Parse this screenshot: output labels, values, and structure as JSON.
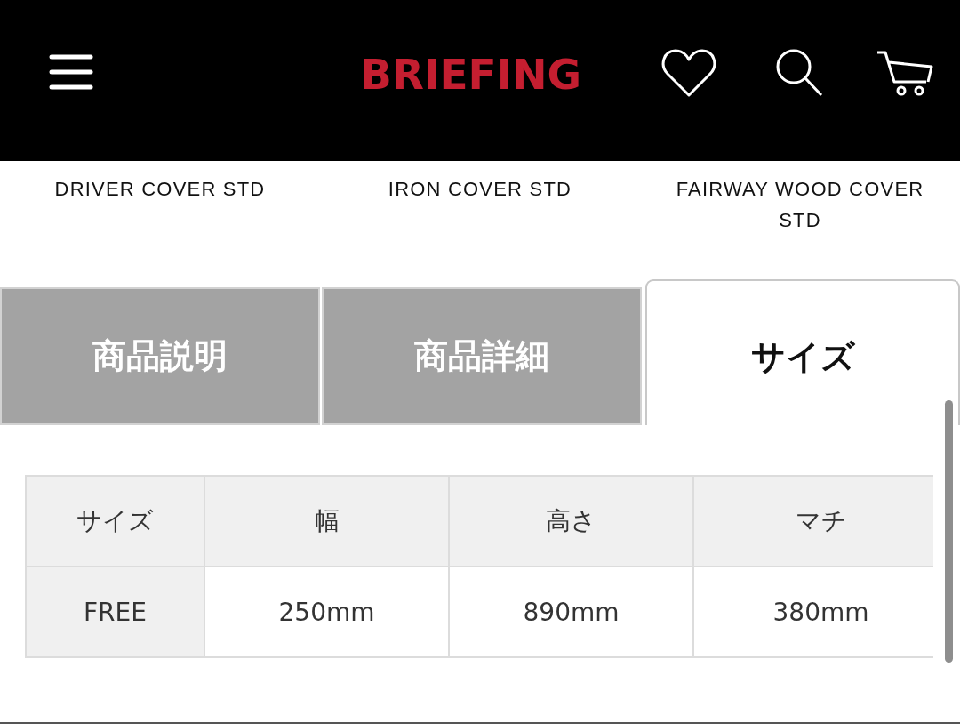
{
  "header": {
    "logo": "BRIEFING"
  },
  "products": [
    "DRIVER COVER STD",
    "IRON COVER STD",
    "FAIRWAY WOOD COVER STD"
  ],
  "tabs": [
    {
      "label": "商品説明",
      "selected": false
    },
    {
      "label": "商品詳細",
      "selected": false
    },
    {
      "label": "サイズ",
      "selected": true
    }
  ],
  "size_table": {
    "columns": [
      "サイズ",
      "幅",
      "高さ",
      "マチ"
    ],
    "rows": [
      [
        "FREE",
        "250mm",
        "890mm",
        "380mm"
      ]
    ]
  }
}
